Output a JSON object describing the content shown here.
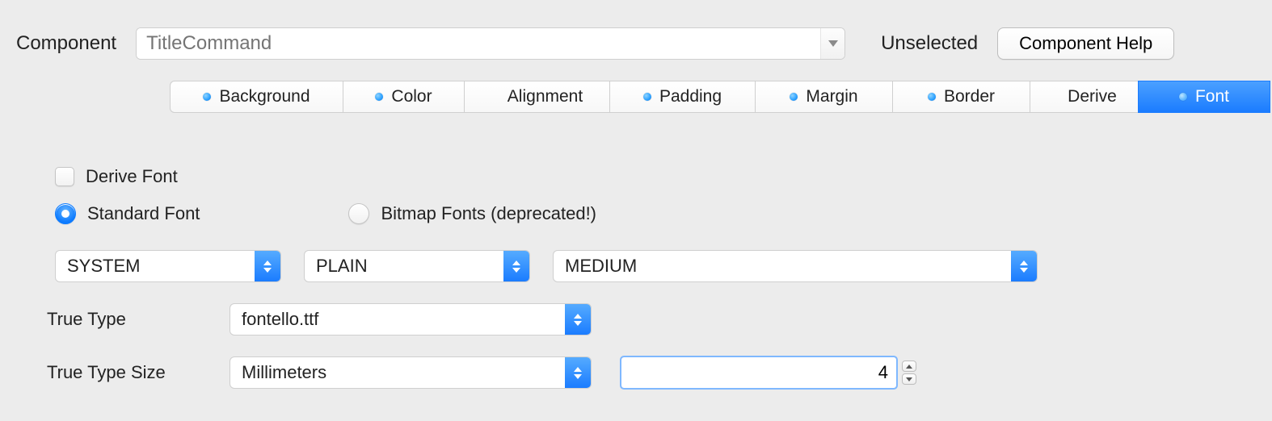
{
  "header": {
    "component_label": "Component",
    "component_value": "TitleCommand",
    "state_label": "Unselected",
    "help_button": "Component Help"
  },
  "tabs": [
    {
      "label": "Background",
      "indicator": true,
      "selected": false
    },
    {
      "label": "Color",
      "indicator": true,
      "selected": false
    },
    {
      "label": "Alignment",
      "indicator": false,
      "selected": false
    },
    {
      "label": "Padding",
      "indicator": true,
      "selected": false
    },
    {
      "label": "Margin",
      "indicator": true,
      "selected": false
    },
    {
      "label": "Border",
      "indicator": true,
      "selected": false
    },
    {
      "label": "Derive",
      "indicator": false,
      "selected": false
    },
    {
      "label": "Font",
      "indicator": true,
      "selected": true
    }
  ],
  "font_panel": {
    "derive_checkbox_label": "Derive Font",
    "derive_checked": false,
    "radio_standard_label": "Standard Font",
    "radio_bitmap_label": "Bitmap Fonts (deprecated!)",
    "radio_selected": "standard",
    "system_select": "SYSTEM",
    "style_select": "PLAIN",
    "size_select": "MEDIUM",
    "truetype_label": "True Type",
    "truetype_file": "fontello.ttf",
    "truetype_size_label": "True Type Size",
    "truetype_size_unit": "Millimeters",
    "truetype_size_value": "4"
  }
}
